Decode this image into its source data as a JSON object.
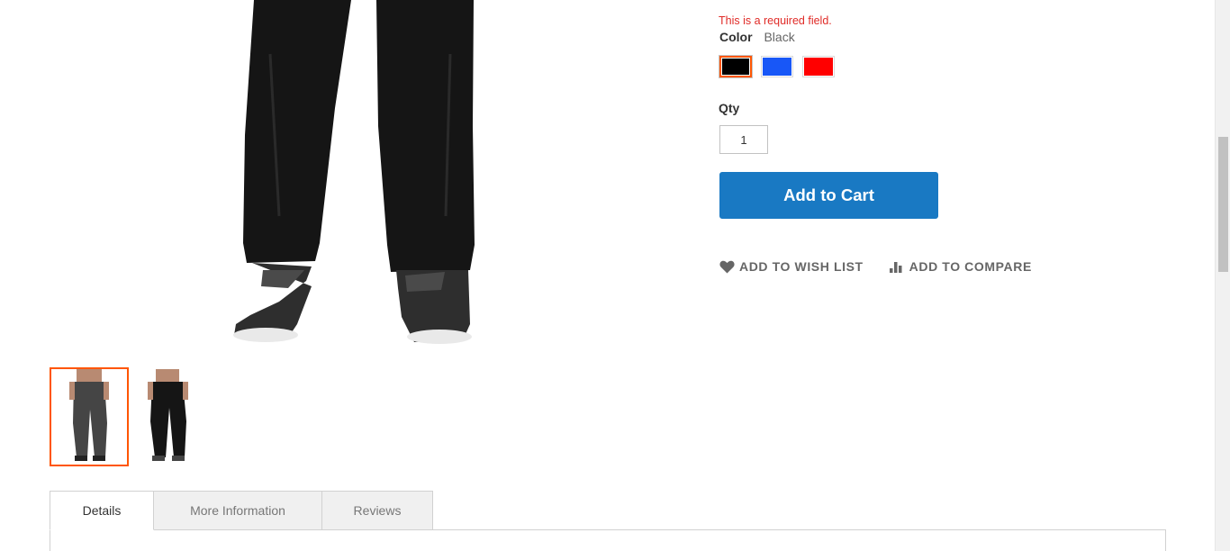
{
  "product": {
    "main_image_name": "black sweatpants with sneakers",
    "thumbnails": [
      {
        "name": "gray sweatpants front view",
        "active": true
      },
      {
        "name": "black sweatpants front view",
        "active": false
      }
    ]
  },
  "options": {
    "required_message": "This is a required field.",
    "color_label": "Color",
    "color_selected": "Black",
    "swatches": [
      {
        "name": "Black",
        "hex": "#000000",
        "selected": true
      },
      {
        "name": "Blue",
        "hex": "#1857f7",
        "selected": false
      },
      {
        "name": "Red",
        "hex": "#ff0000",
        "selected": false
      }
    ],
    "qty_label": "Qty",
    "qty_value": "1"
  },
  "buttons": {
    "add_to_cart": "Add to Cart",
    "add_to_wishlist": "ADD TO WISH LIST",
    "add_to_compare": "ADD TO COMPARE"
  },
  "tabs": [
    {
      "label": "Details",
      "active": true
    },
    {
      "label": "More Information",
      "active": false
    },
    {
      "label": "Reviews",
      "active": false
    }
  ],
  "colors": {
    "accent": "#1979c3",
    "selected_outline": "#ff5501",
    "error": "#e02b27"
  },
  "icons": {
    "wishlist": "heart-icon",
    "compare": "bar-chart-icon"
  }
}
